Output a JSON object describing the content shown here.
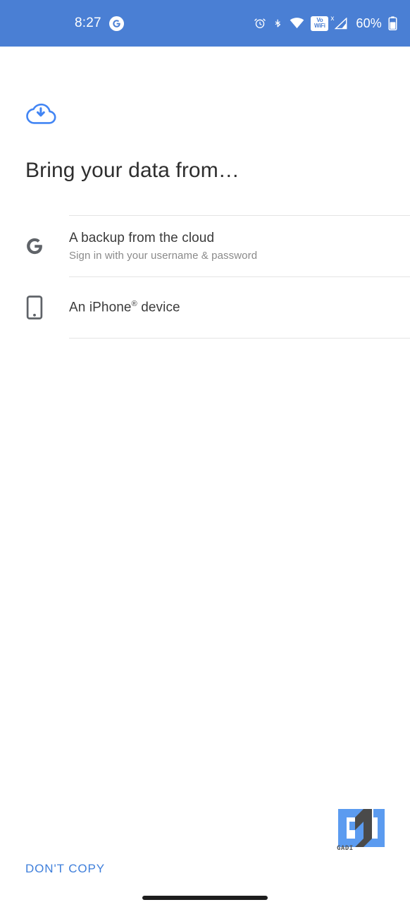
{
  "status_bar": {
    "time": "8:27",
    "assistant_icon": "google-g-icon",
    "icons": [
      "alarm-icon",
      "bluetooth-icon",
      "wifi-icon",
      "vowifi-icon",
      "signal-no-service-icon",
      "battery-icon"
    ],
    "vowifi_line1": "Vo",
    "vowifi_line2": "WiFi",
    "signal_x_label": "x",
    "battery_percent": "60%",
    "background_color": "#4a7fd4",
    "text_color": "#ffffff"
  },
  "main": {
    "hero_icon": "cloud-download-icon",
    "hero_icon_color": "#4285f4",
    "headline": "Bring your data from…",
    "options": [
      {
        "icon": "google-g-icon",
        "title": "A backup from the cloud",
        "subtitle": "Sign in with your username & password"
      },
      {
        "icon": "iphone-device-icon",
        "title_prefix": "An iPhone",
        "title_sup": "®",
        "title_suffix": " device",
        "subtitle": ""
      }
    ]
  },
  "footer": {
    "dont_copy_label": "DON'T COPY",
    "dont_copy_color": "#3f7fdb"
  },
  "watermark": {
    "label": "GADI",
    "primary_color": "#5b9bf0",
    "shadow_color": "#4a4a4a"
  },
  "navigation": {
    "gesture_pill": "home-gesture-pill"
  }
}
